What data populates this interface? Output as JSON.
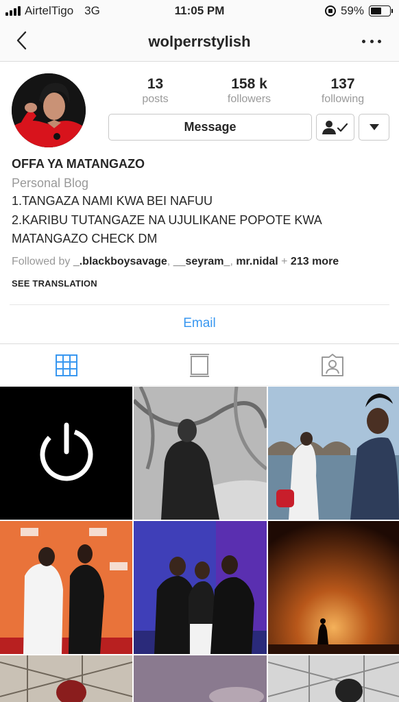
{
  "status_bar": {
    "carrier": "AirtelTigo",
    "network": "3G",
    "time": "11:05 PM",
    "battery_pct": "59%",
    "battery_level": 0.59
  },
  "nav": {
    "title": "wolperrstylish",
    "back_icon": "chevron-left-icon",
    "more_icon": "more-horizontal-icon"
  },
  "profile": {
    "stats": [
      {
        "value": "13",
        "label": "posts"
      },
      {
        "value": "158 k",
        "label": "followers"
      },
      {
        "value": "137",
        "label": "following"
      }
    ],
    "message_label": "Message",
    "name": "OFFA YA MATANGAZO",
    "category": "Personal Blog",
    "bio_lines": [
      "1.TANGAZA NAMI KWA BEI NAFUU",
      "2.KARIBU TUTANGAZE NA UJULIKANE POPOTE KWA",
      "MATANGAZO CHECK DM"
    ],
    "followed_by": {
      "prefix": "Followed by ",
      "users": [
        "_.blackboysavage",
        "__seyram_",
        "mr.nidal"
      ],
      "sep": ", ",
      "plus": " + ",
      "more": "213 more"
    },
    "see_translation": "SEE TRANSLATION",
    "email_label": "Email"
  },
  "tabs": [
    {
      "name": "grid",
      "icon": "grid-icon",
      "active": true
    },
    {
      "name": "feed",
      "icon": "feed-icon",
      "active": false
    },
    {
      "name": "tagged",
      "icon": "tagged-user-icon",
      "active": false
    }
  ],
  "colors": {
    "link_blue": "#3897f0",
    "muted_gray": "#999999",
    "text": "#262626"
  },
  "posts": [
    {
      "label": "post-power-icon"
    },
    {
      "label": "post-bw-portrait"
    },
    {
      "label": "post-bridge-river"
    },
    {
      "label": "post-bet-awards-duo"
    },
    {
      "label": "post-bet-group"
    },
    {
      "label": "post-sunset-silhouette"
    },
    {
      "label": "post-fence-portrait"
    },
    {
      "label": "post-sky"
    },
    {
      "label": "post-fence-cap"
    }
  ]
}
